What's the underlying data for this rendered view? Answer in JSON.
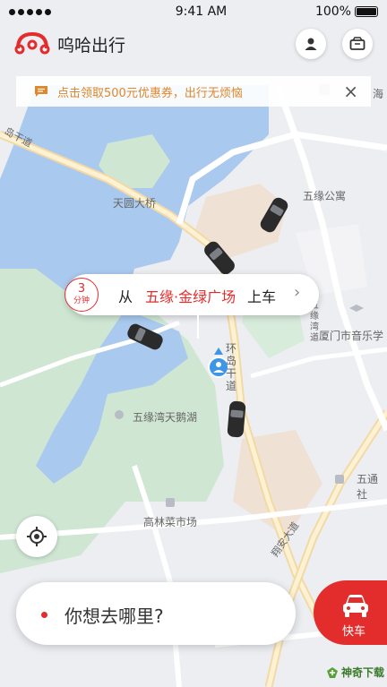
{
  "status_bar": {
    "time": "9:41 AM",
    "battery": "100%"
  },
  "header": {
    "title": "呜哈出行",
    "profile_icon": "person-icon",
    "wallet_icon": "wallet-icon"
  },
  "banner": {
    "text": "点击领取500元优惠券，出行无烦恼",
    "close": "×"
  },
  "map_labels": {
    "bridge": "天圆大桥",
    "apartment": "五缘公寓",
    "lake": "五缘湾天鹅湖",
    "music_school": "厦门市音乐学",
    "market": "高林菜市场",
    "wutong": "五通社",
    "road_ring": "环岛干道",
    "road_left": "岛干道",
    "road_hm": "五缘湾道",
    "road_xiangan": "翔安大道",
    "partial_top": "海"
  },
  "pickup": {
    "eta_number": "3",
    "eta_unit": "分钟",
    "from": "从",
    "place": "五缘·金绿广场",
    "suffix": "上车",
    "arrow": "›"
  },
  "destination": {
    "placeholder": "你想去哪里?"
  },
  "ride_button": {
    "label": "快车"
  },
  "watermark": {
    "text": "神奇下载"
  },
  "colors": {
    "accent": "#e32d2d",
    "banner_text": "#e0862b",
    "water": "#a9c9ee",
    "green": "#cfe6d3"
  }
}
